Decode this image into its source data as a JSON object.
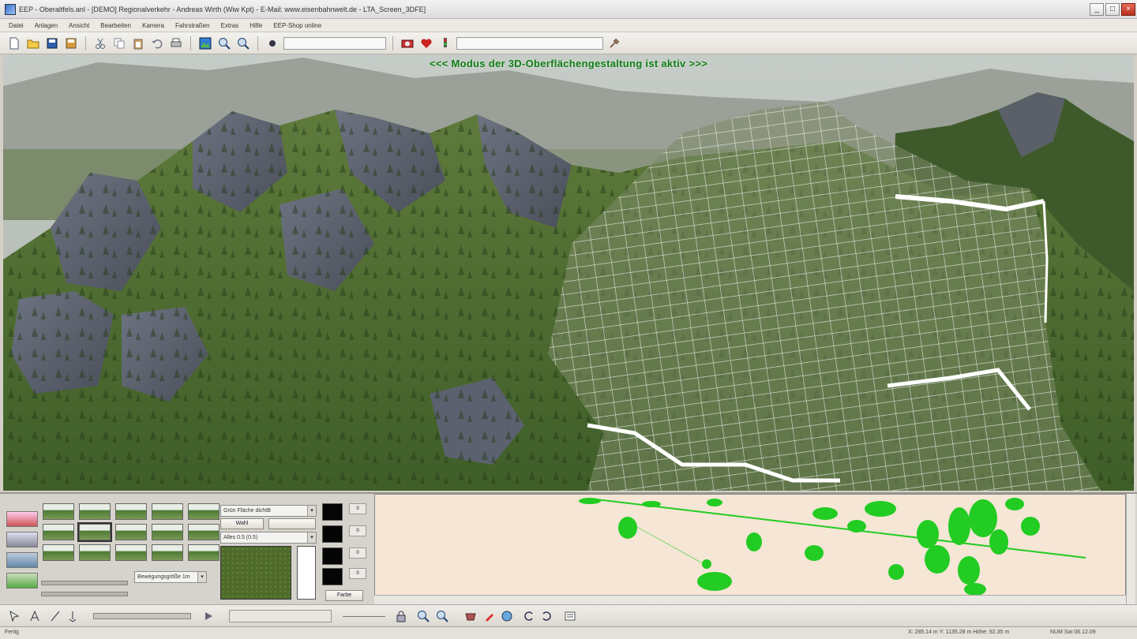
{
  "window": {
    "title": "EEP - Oberaltfels.anl - [DEMO] Regionalverkehr - Andreas Wirth (Wiw Kpt) - E-Mail: www.eisenbahnwelt.de - LTA_Screen_3DFE]",
    "minimize": "_",
    "maximize": "□",
    "close": "×"
  },
  "menu": {
    "items": [
      "Datei",
      "Anlagen",
      "Ansicht",
      "Bearbeiten",
      "Kamera",
      "Fahrstraßen",
      "Extras",
      "Hilfe",
      "EEP-Shop online"
    ]
  },
  "toolbar": {
    "zoom_field": "",
    "search_field": "",
    "icons": [
      "new-icon",
      "open-icon",
      "save-icon",
      "save-as-icon",
      "cut-icon",
      "copy-icon",
      "paste-icon",
      "undo-icon",
      "print-icon",
      "terrain-icon",
      "zoom-in-icon",
      "zoom-out-icon",
      "camera-icon",
      "heart-icon",
      "signal-icon",
      "tools-icon"
    ]
  },
  "viewport": {
    "mode_text": "<<<  Modus der 3D-Oberflächengestaltung ist aktiv  >>>"
  },
  "terrain_panel": {
    "texture_dropdown": "Grün Fläche dichtB",
    "texture_button": "Wahl",
    "layer_dropdown": "Alles 0.5 (0.5)",
    "height_dropdown": "Bewegungsgröße 1m",
    "color_label": "Farbe",
    "spin_values": [
      "0",
      "0",
      "0",
      "0"
    ],
    "brush_count": 15,
    "selected_brush": 6
  },
  "status": {
    "left": "Fertig",
    "coords": "X: 285.14 m  Y: 1135.28 m  Höhe: 92.35 m",
    "right": "NUM  Sat 06.12.09"
  },
  "colors": {
    "accent_green": "#137a1a",
    "minimap_bg": "#f6e6d6",
    "minimap_blob": "#22cc22"
  }
}
